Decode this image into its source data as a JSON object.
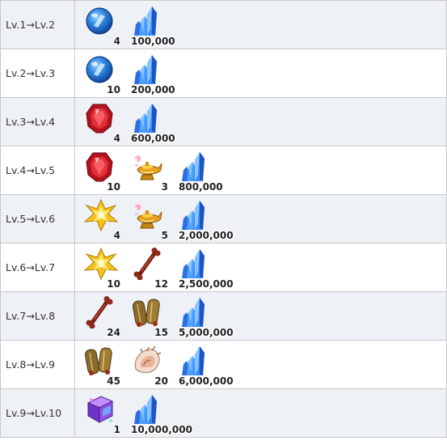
{
  "rows": [
    {
      "level": "Lv.1→Lv.2",
      "materials": [
        {
          "icon": "blue-orb-icon",
          "qty": "4"
        },
        {
          "icon": "crystal-icon",
          "qty": "100,000"
        }
      ]
    },
    {
      "level": "Lv.2→Lv.3",
      "materials": [
        {
          "icon": "blue-orb-icon",
          "qty": "10"
        },
        {
          "icon": "crystal-icon",
          "qty": "200,000"
        }
      ]
    },
    {
      "level": "Lv.3→Lv.4",
      "materials": [
        {
          "icon": "red-gem-icon",
          "qty": "4"
        },
        {
          "icon": "crystal-icon",
          "qty": "600,000"
        }
      ]
    },
    {
      "level": "Lv.4→Lv.5",
      "materials": [
        {
          "icon": "red-gem-icon",
          "qty": "10"
        },
        {
          "icon": "golden-lamp-icon",
          "qty": "3"
        },
        {
          "icon": "crystal-icon",
          "qty": "800,000"
        }
      ]
    },
    {
      "level": "Lv.5→Lv.6",
      "materials": [
        {
          "icon": "gold-star-icon",
          "qty": "4"
        },
        {
          "icon": "golden-lamp-icon",
          "qty": "5"
        },
        {
          "icon": "crystal-icon",
          "qty": "2,000,000"
        }
      ]
    },
    {
      "level": "Lv.6→Lv.7",
      "materials": [
        {
          "icon": "gold-star-icon",
          "qty": "10"
        },
        {
          "icon": "bone-icon",
          "qty": "12"
        },
        {
          "icon": "crystal-icon",
          "qty": "2,500,000"
        }
      ]
    },
    {
      "level": "Lv.7→Lv.8",
      "materials": [
        {
          "icon": "bone-icon",
          "qty": "24"
        },
        {
          "icon": "scroll-icon",
          "qty": "15"
        },
        {
          "icon": "crystal-icon",
          "qty": "5,000,000"
        }
      ]
    },
    {
      "level": "Lv.8→Lv.9",
      "materials": [
        {
          "icon": "scroll-icon",
          "qty": "45"
        },
        {
          "icon": "seashell-icon",
          "qty": "20"
        },
        {
          "icon": "crystal-icon",
          "qty": "6,000,000"
        }
      ]
    },
    {
      "level": "Lv.9→Lv.10",
      "materials": [
        {
          "icon": "purple-cube-icon",
          "qty": "1"
        },
        {
          "icon": "crystal-icon",
          "qty": "10,000,000"
        }
      ]
    }
  ]
}
